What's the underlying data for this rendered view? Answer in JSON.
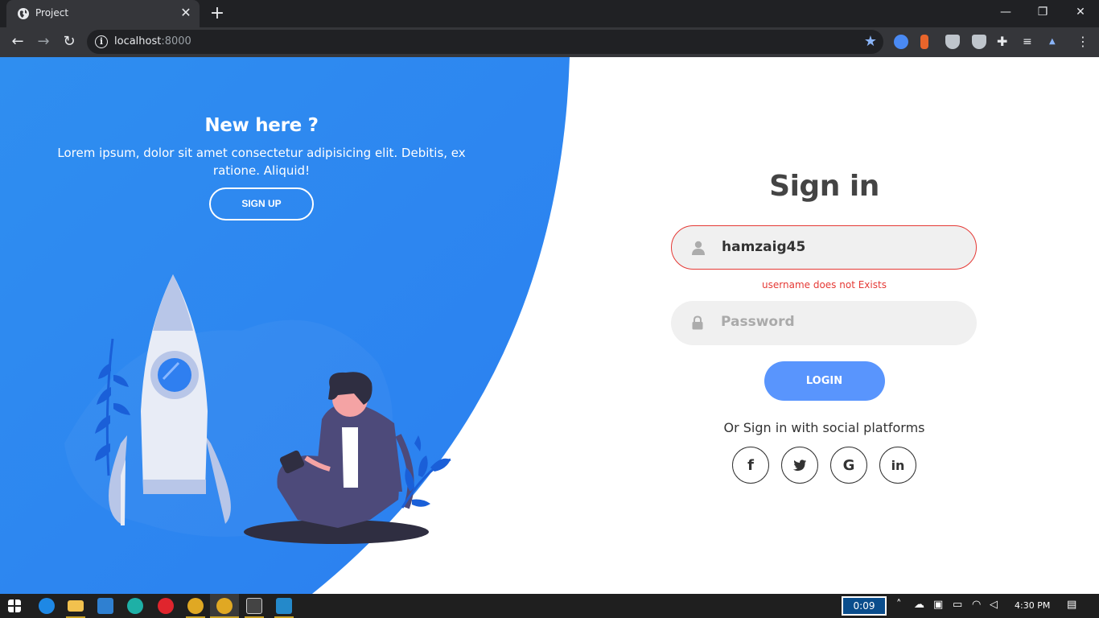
{
  "browser": {
    "tab_title": "Project",
    "url_host": "localhost",
    "url_port": ":8000"
  },
  "left_panel": {
    "title": "New here ?",
    "text": "Lorem ipsum, dolor sit amet consectetur adipisicing elit. Debitis, ex ratione. Aliquid!",
    "signup_label": "SIGN UP"
  },
  "signin": {
    "title": "Sign in",
    "username_value": "hamzaig45",
    "username_error": "username does not Exists",
    "password_placeholder": "Password",
    "login_label": "LOGIN",
    "social_text": "Or Sign in with social platforms",
    "social": [
      {
        "icon": "facebook-icon",
        "glyph": "f"
      },
      {
        "icon": "twitter-icon",
        "glyph": "🐦"
      },
      {
        "icon": "google-icon",
        "glyph": "G"
      },
      {
        "icon": "linkedin-icon",
        "glyph": "in"
      }
    ]
  },
  "taskbar": {
    "timer": "0:09",
    "clock": "4:30 PM"
  },
  "colors": {
    "accent_blue": "#5995fd",
    "panel_blue_start": "#4481eb",
    "panel_blue_end": "#04befe",
    "error_red": "#e53935"
  }
}
